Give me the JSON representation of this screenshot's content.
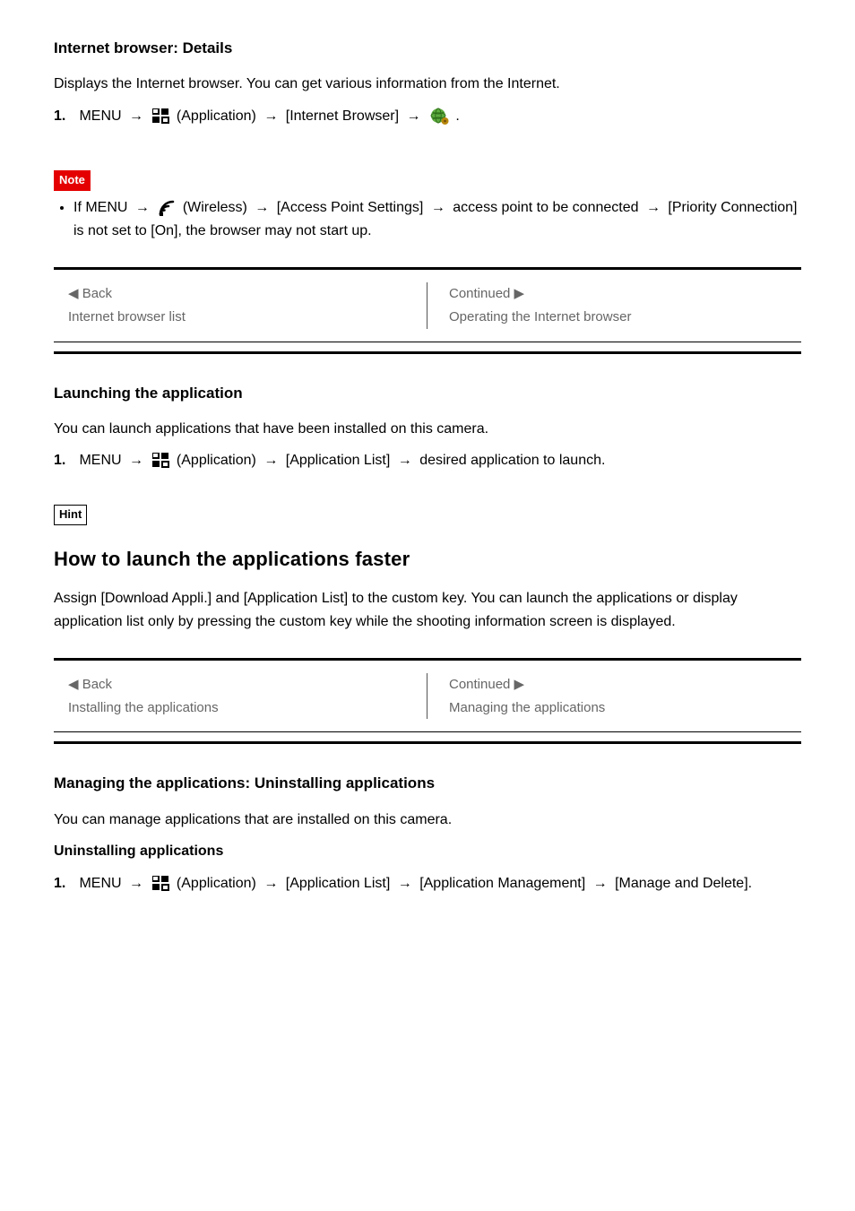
{
  "section1": {
    "heading": "Internet browser: Details",
    "intro": "Displays the Internet browser. You can get various information from the Internet.",
    "step_num": "1.",
    "menu_label": "MENU",
    "apps_label": "(Application)",
    "browser_label": "[Internet Browser]",
    "earth_after": "."
  },
  "note": {
    "badge": "Note",
    "bullet_pre": "If MENU",
    "wireless_label": "(Wireless)",
    "ap_label": "[Access Point Settings]",
    "ap_mid": "access point to be connected",
    "priority": "[Priority Connection] is not set to [On], the browser may not start up."
  },
  "nav1": {
    "back_label": "◀ Back",
    "back_target": "Internet browser list",
    "next_label": "Continued ▶",
    "next_target": "Operating the Internet browser"
  },
  "section2": {
    "heading": "Launching the application",
    "intro": "You can launch applications that have been installed on this camera.",
    "step_num": "1.",
    "menu_label": "MENU",
    "apps_label": "(Application)",
    "app_list_label": "[Application List]",
    "desired": "desired application to launch."
  },
  "hint": {
    "badge": "Hint",
    "title": "How to launch the applications faster",
    "body": "Assign [Download Appli.] and [Application List] to the custom key. You can launch the applications or display application list only by pressing the custom key while the shooting information screen is displayed."
  },
  "nav2": {
    "back_label": "◀ Back",
    "back_target": "Installing the applications",
    "next_label": "Continued ▶",
    "next_target": "Managing the applications"
  },
  "section3": {
    "heading": "Managing the applications: Uninstalling applications",
    "intro": "You can manage applications that are installed on this camera.",
    "sub": "Uninstalling applications",
    "step_num": "1.",
    "menu_label": "MENU",
    "apps_label": "(Application)",
    "app_list_label": "[Application List]",
    "manage_label": "[Application Management]",
    "manage_delete": "[Manage and Delete]."
  }
}
